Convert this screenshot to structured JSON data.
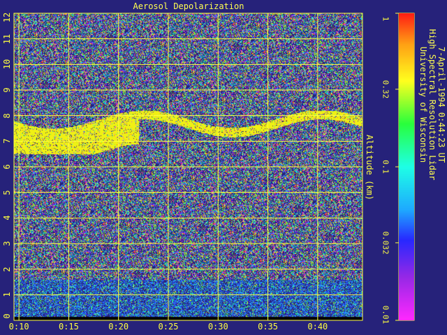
{
  "chart_data": {
    "type": "heatmap",
    "title": "Aerosol Depolarization",
    "xlabel": "",
    "ylabel": "Altitude (km)",
    "x_ticks": [
      "0:10",
      "0:15",
      "0:20",
      "0:25",
      "0:30",
      "0:35",
      "0:40"
    ],
    "x_tick_minutes": [
      10,
      15,
      20,
      25,
      30,
      35,
      40
    ],
    "xlim_minutes": [
      9.5,
      44.5
    ],
    "y_ticks": [
      "0",
      "1",
      "2",
      "3",
      "4",
      "5",
      "6",
      "7",
      "8",
      "9",
      "10",
      "11",
      "12"
    ],
    "ylim": [
      0,
      12
    ],
    "colorbar": {
      "scale": "log",
      "range": [
        0.01,
        1
      ],
      "tick_labels": [
        "1",
        "0.32",
        "0.1",
        "0.032",
        "0.01"
      ],
      "tick_values": [
        1,
        0.32,
        0.1,
        0.032,
        0.01
      ]
    },
    "grid": true,
    "features": [
      {
        "layer": "aerosol",
        "altitude_km": [
          6.5,
          8.2
        ],
        "time_minutes": [
          9.5,
          44.5
        ]
      }
    ]
  },
  "credits": {
    "line1": "University of Wisconsin",
    "line2": "High Spectral Resolution Lidar",
    "line3": "7-April-1994  0:44:23 UT"
  },
  "colors": {
    "background": "#26227a",
    "grid": "#ffff40",
    "text": "#ffff40"
  }
}
